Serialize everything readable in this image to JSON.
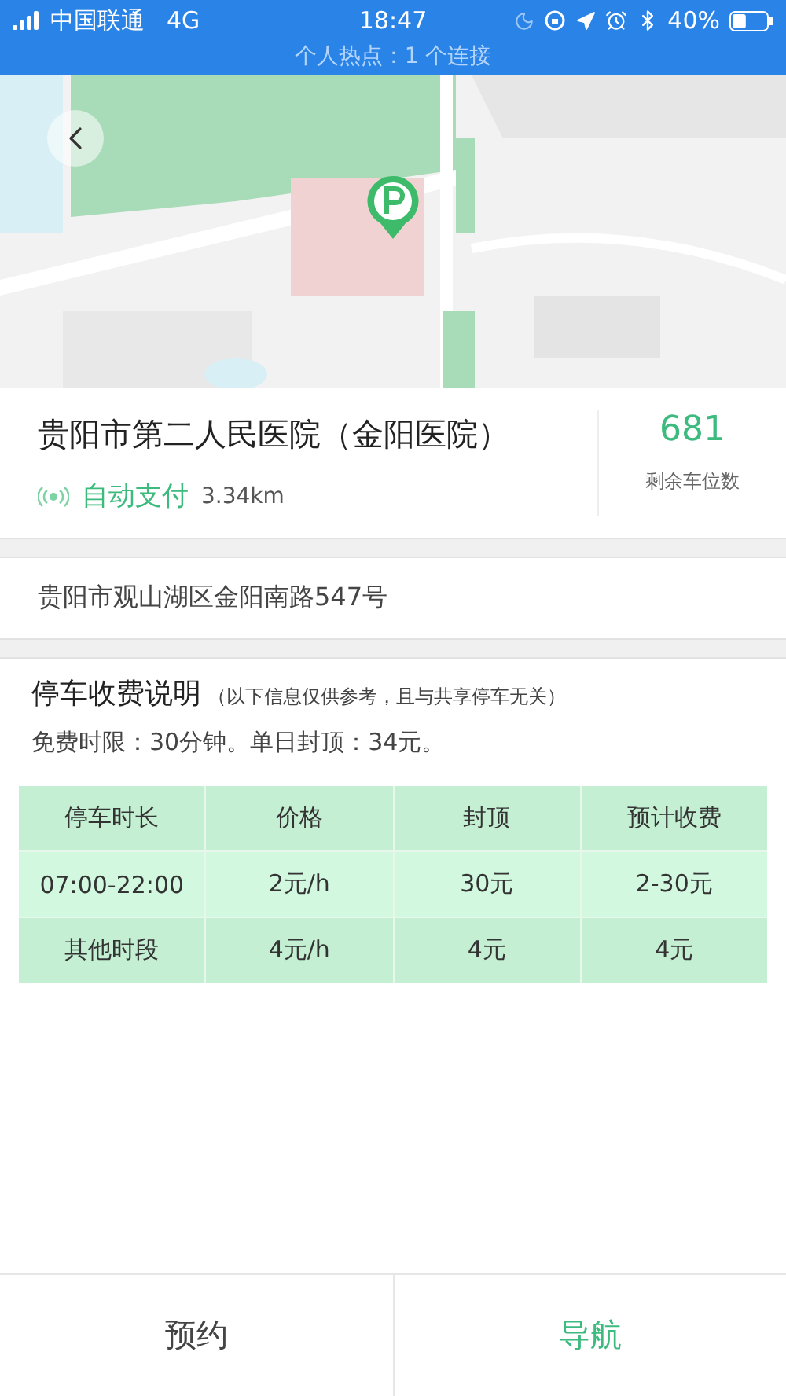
{
  "status_bar": {
    "carrier": "中国联通",
    "network": "4G",
    "time": "18:47",
    "battery": "40%",
    "hotspot": "个人热点：1 个连接"
  },
  "lot": {
    "name": "贵阳市第二人民医院（金阳医院）",
    "payment": "自动支付",
    "distance": "3.34km",
    "spaces": "681",
    "spaces_label": "剩余车位数"
  },
  "address": "贵阳市观山湖区金阳南路547号",
  "fees": {
    "title": "停车收费说明",
    "note": "（以下信息仅供参考，且与共享停车无关）",
    "summary": "免费时限：30分钟。单日封顶：34元。",
    "columns": [
      "停车时长",
      "价格",
      "封顶",
      "预计收费"
    ],
    "rows": [
      [
        "07:00-22:00",
        "2元/h",
        "30元",
        "2-30元"
      ],
      [
        "其他时段",
        "4元/h",
        "4元",
        "4元"
      ]
    ]
  },
  "actions": [
    {
      "label": "预约",
      "primary": false
    },
    {
      "label": "导航",
      "primary": true
    }
  ]
}
